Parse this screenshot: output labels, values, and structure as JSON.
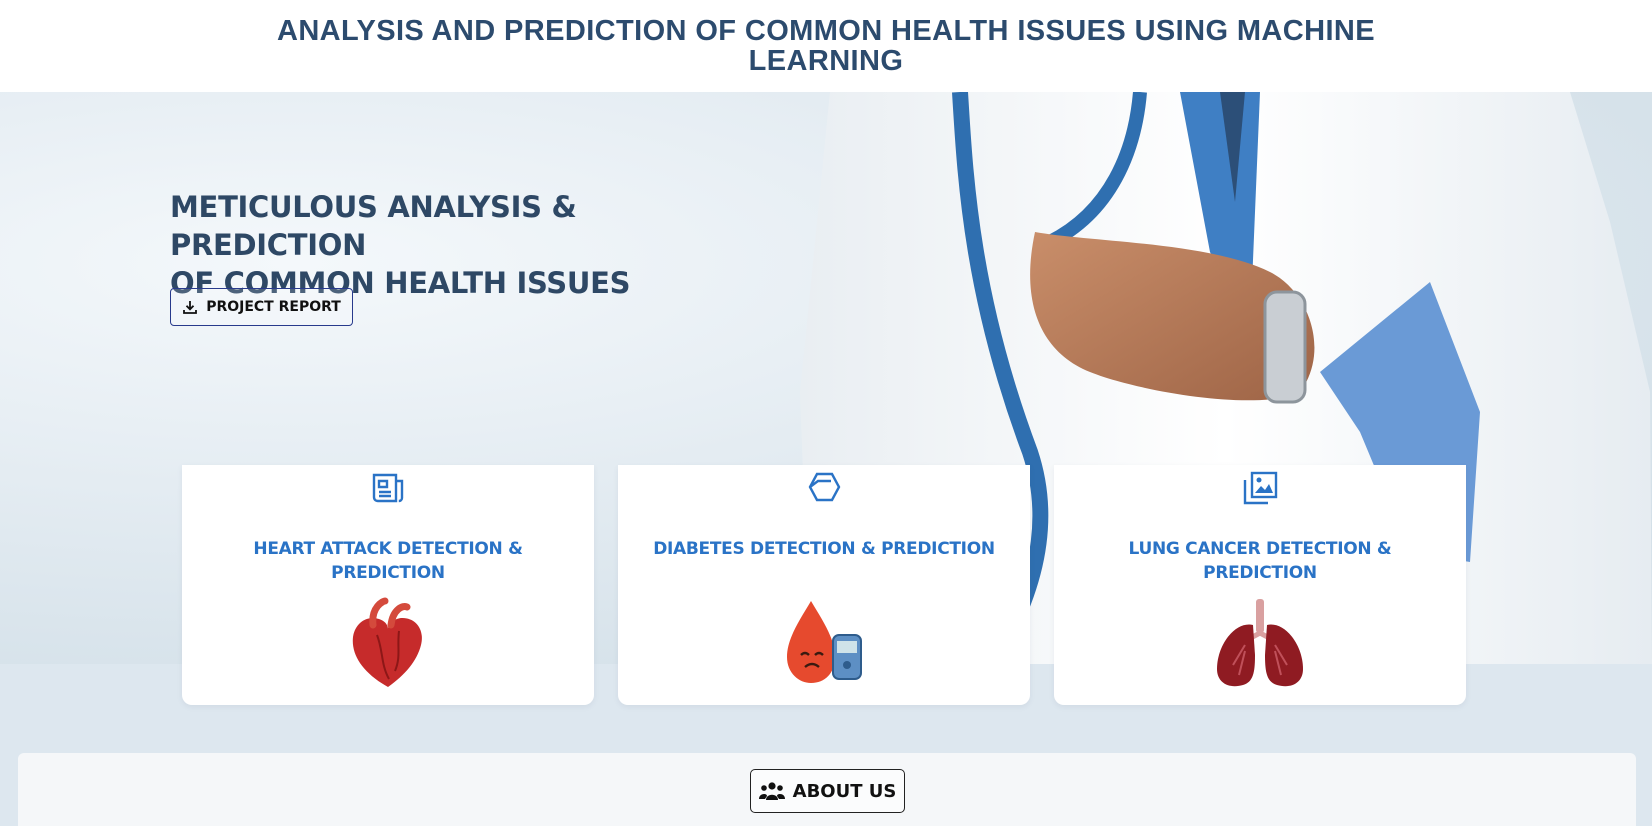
{
  "header": {
    "title": "ANALYSIS AND PREDICTION OF COMMON HEALTH ISSUES USING MACHINE LEARNING"
  },
  "hero": {
    "title_line1": "METICULOUS ANALYSIS & PREDICTION",
    "title_line2": "OF COMMON HEALTH ISSUES",
    "report_button_label": "PROJECT REPORT",
    "report_icon": "download-icon"
  },
  "cards": [
    {
      "title": "HEART ATTACK DETECTION & PREDICTION",
      "icon": "document-icon",
      "art": "heart-illustration"
    },
    {
      "title": "DIABETES DETECTION & PREDICTION",
      "icon": "cube-icon",
      "art": "blood-drop-glucometer-illustration"
    },
    {
      "title": "LUNG CANCER DETECTION & PREDICTION",
      "icon": "images-icon",
      "art": "lungs-illustration"
    }
  ],
  "about": {
    "button_label": "ABOUT US",
    "icon": "users-icon"
  },
  "colors": {
    "accent": "#2a73c6",
    "heading": "#2c4b6e",
    "button_border": "#283a8c"
  }
}
